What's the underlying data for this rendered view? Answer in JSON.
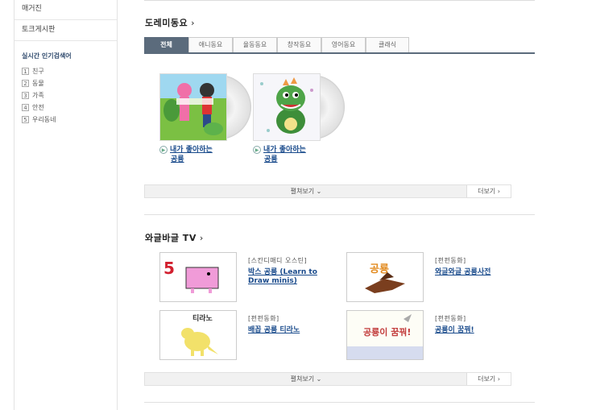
{
  "sidebar": {
    "links": [
      "매거진",
      "토크게시판"
    ],
    "popular_title": "실시간 인기검색어",
    "ranks": [
      {
        "num": "1",
        "label": "친구"
      },
      {
        "num": "2",
        "label": "동물"
      },
      {
        "num": "3",
        "label": "가족"
      },
      {
        "num": "4",
        "label": "안전"
      },
      {
        "num": "5",
        "label": "우리동네"
      }
    ]
  },
  "section1": {
    "title": "도레미동요",
    "arrow": "›",
    "tabs": [
      "전체",
      "애니동요",
      "율동동요",
      "창작동요",
      "영어동요",
      "클래식"
    ],
    "albums": [
      {
        "title_line1": "내가 좋아하는",
        "title_line2": "공룡"
      },
      {
        "title_line1": "내가 좋아하는",
        "title_line2": "공룡"
      }
    ],
    "expand": "펼쳐보기",
    "expand_icon": "⌄",
    "more": "더보기",
    "more_icon": "›"
  },
  "section2": {
    "title": "와글바글 TV",
    "arrow": "›",
    "videos": [
      {
        "category": "[스칸디매디 오스틴]",
        "title": "박스 공룡 (Learn to Draw minis)",
        "thumb_text": "5"
      },
      {
        "category": "[펀펀동화]",
        "title": "와글와글 공룡사전",
        "thumb_text": "공룡"
      },
      {
        "category": "[펀펀동화]",
        "title": "배꼽 공룡 티라노",
        "thumb_text": "티라노"
      },
      {
        "category": "[펀펀동화]",
        "title": "공룡이 꿈꿔!",
        "thumb_text": "공룡이 꿈꿔!"
      }
    ],
    "expand": "펼쳐보기",
    "expand_icon": "⌄",
    "more": "더보기",
    "more_icon": "›"
  },
  "colors": {
    "tab_active": "#5b6b7c",
    "link": "#1a4b8c"
  }
}
